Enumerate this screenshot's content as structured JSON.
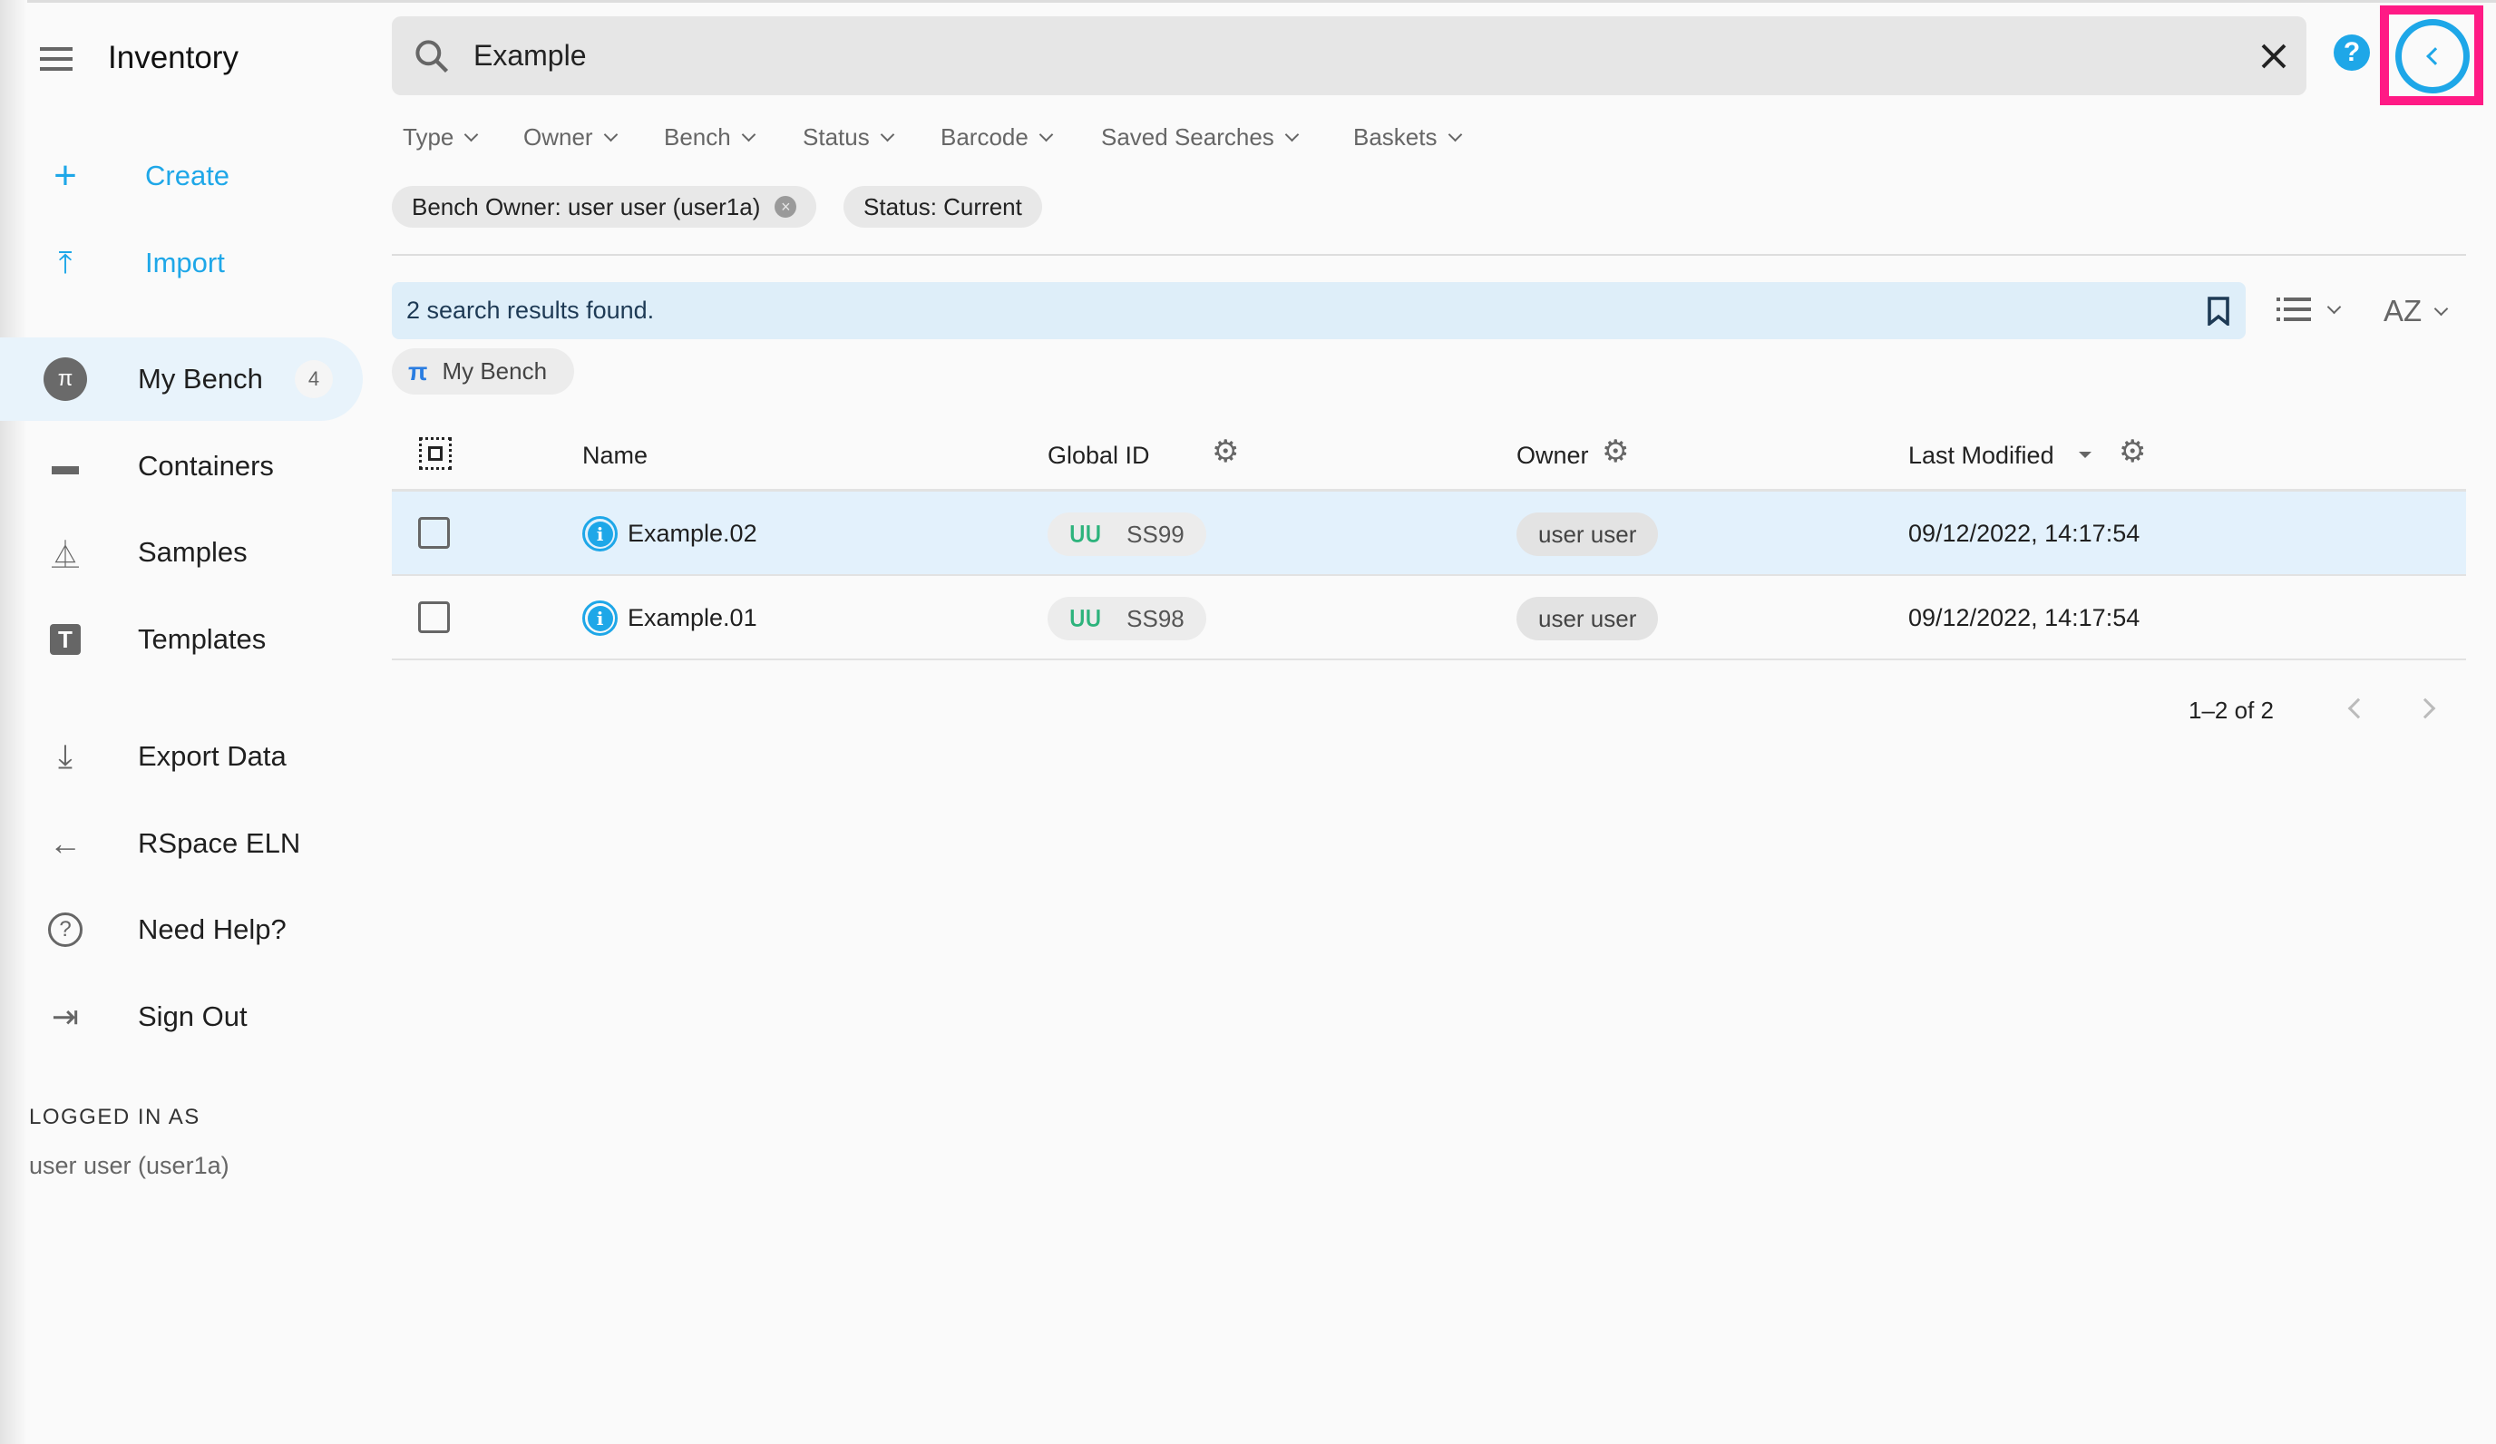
{
  "sidebar": {
    "title": "Inventory",
    "actions": [
      {
        "label": "Create",
        "icon": "plus-icon"
      },
      {
        "label": "Import",
        "icon": "upload-icon"
      }
    ],
    "items": [
      {
        "label": "My Bench",
        "icon": "bench-icon",
        "badge": "4",
        "active": true
      },
      {
        "label": "Containers",
        "icon": "container-icon"
      },
      {
        "label": "Samples",
        "icon": "flask-icon"
      },
      {
        "label": "Templates",
        "icon": "template-icon"
      },
      {
        "label": "Export Data",
        "icon": "download-icon"
      },
      {
        "label": "RSpace ELN",
        "icon": "arrow-left-icon"
      },
      {
        "label": "Need Help?",
        "icon": "help-circle-icon"
      },
      {
        "label": "Sign Out",
        "icon": "sign-out-icon"
      }
    ],
    "logged_in_label": "LOGGED IN AS",
    "logged_in_user": "user user (user1a)"
  },
  "search": {
    "value": "Example"
  },
  "filters": [
    "Type",
    "Owner",
    "Bench",
    "Status",
    "Barcode",
    "Saved Searches",
    "Baskets"
  ],
  "chips": [
    "Bench Owner: user user (user1a)",
    "Status: Current"
  ],
  "results": {
    "message": "2 search results found.",
    "bench_chip": "My Bench",
    "sort_label": "AZ"
  },
  "table": {
    "headers": {
      "name": "Name",
      "global_id": "Global ID",
      "owner": "Owner",
      "last_modified": "Last Modified"
    },
    "rows": [
      {
        "name": "Example.02",
        "global_id": "SS99",
        "owner": "user user",
        "last_modified": "09/12/2022, 14:17:54",
        "highlighted": true
      },
      {
        "name": "Example.01",
        "global_id": "SS98",
        "owner": "user user",
        "last_modified": "09/12/2022, 14:17:54"
      }
    ]
  },
  "pagination": {
    "label": "1–2 of 2"
  },
  "colors": {
    "accent": "#1ea7e8",
    "highlight_box": "#ff1a85",
    "sample_icon": "#2db37c"
  }
}
